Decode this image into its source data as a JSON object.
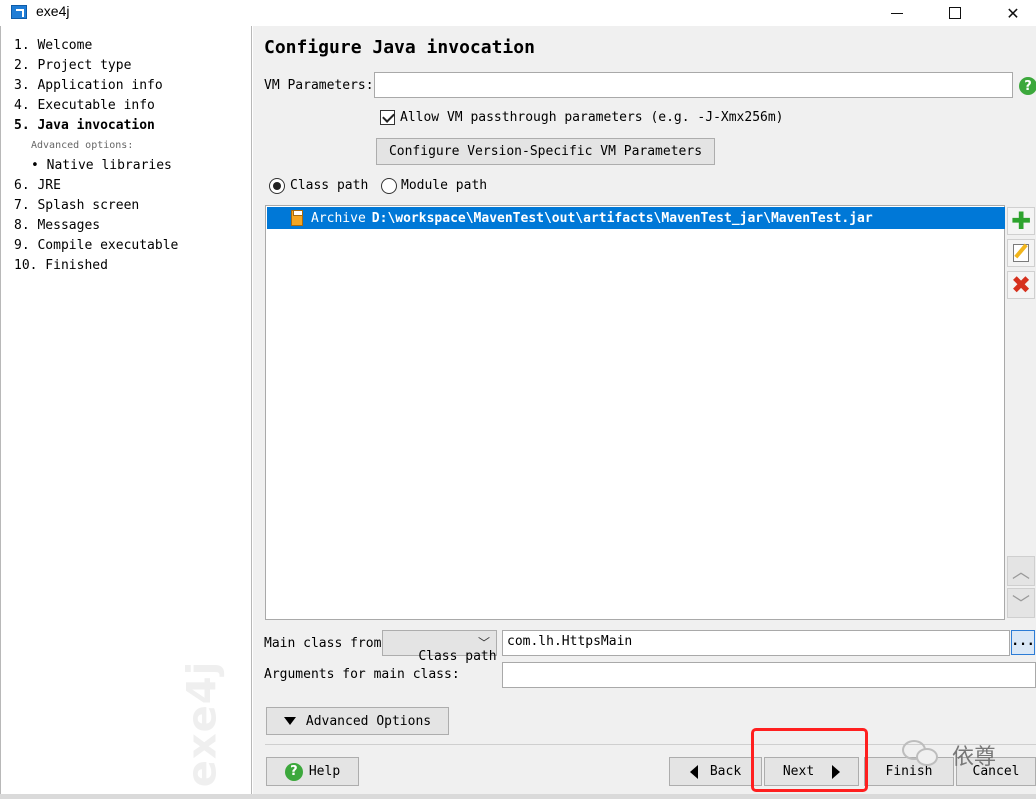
{
  "window": {
    "title": "exe4j"
  },
  "steps": {
    "items": [
      "1. Welcome",
      "2. Project type",
      "3. Application info",
      "4. Executable info",
      "5. Java invocation",
      "6. JRE",
      "7. Splash screen",
      "8. Messages",
      "9. Compile executable",
      "10. Finished"
    ],
    "advanced_label": "Advanced options:",
    "native_libraries": "• Native libraries",
    "active_index": 4,
    "brand": "exe4j"
  },
  "page": {
    "heading": "Configure Java invocation",
    "vm_parameters_label": "VM Parameters:",
    "vm_parameters_value": "",
    "help_glyph": "?",
    "allow_passthrough_label": "Allow VM passthrough parameters (e.g. -J-Xmx256m)",
    "allow_passthrough_checked": true,
    "configure_version_button": "Configure Version-Specific VM Parameters",
    "classpath_mode": {
      "options": [
        "Class path",
        "Module path"
      ],
      "selected": "Class path"
    },
    "classpath_entries": [
      {
        "kind": "Archive",
        "path": "D:\\workspace\\MavenTest\\out\\artifacts\\MavenTest_jar\\MavenTest.jar",
        "selected": true
      }
    ],
    "side_actions": [
      "add-icon",
      "edit-icon",
      "delete-icon"
    ],
    "move_actions": [
      "move-up-icon",
      "move-down-icon"
    ],
    "main_class_from_label": "Main class from",
    "main_class_source": "Class path",
    "main_class_value": "com.lh.HttpsMain",
    "browse_label": "...",
    "arguments_label": "Arguments for main class:",
    "arguments_value": "",
    "advanced_options_button": "Advanced Options"
  },
  "footer": {
    "help": "Help",
    "back": "Back",
    "next": "Next",
    "finish": "Finish",
    "cancel": "Cancel"
  },
  "watermark": {
    "text": "依尊"
  },
  "colors": {
    "selection": "#0078d7",
    "highlight_box": "#ff1f1f",
    "help_green": "#3ca83c",
    "content_bg": "#f0f0f0"
  }
}
